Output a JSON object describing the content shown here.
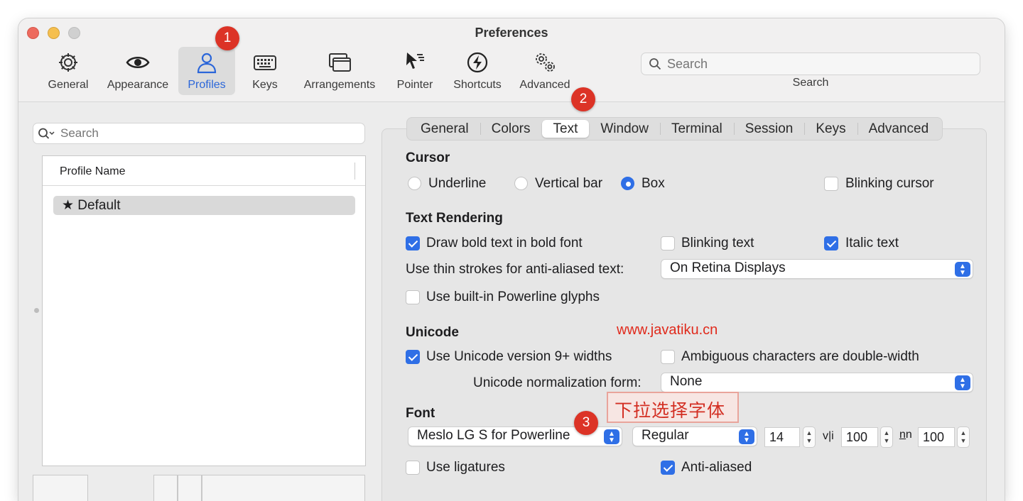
{
  "window": {
    "title": "Preferences"
  },
  "toolbar": {
    "items": [
      {
        "label": "General",
        "icon": "gear-icon"
      },
      {
        "label": "Appearance",
        "icon": "eye-icon"
      },
      {
        "label": "Profiles",
        "icon": "person-icon",
        "selected": true
      },
      {
        "label": "Keys",
        "icon": "keyboard-icon"
      },
      {
        "label": "Arrangements",
        "icon": "window-stack-icon"
      },
      {
        "label": "Pointer",
        "icon": "pointer-icon"
      },
      {
        "label": "Shortcuts",
        "icon": "bolt-icon"
      },
      {
        "label": "Advanced",
        "icon": "gears-icon"
      }
    ],
    "search": {
      "placeholder": "Search",
      "label": "Search"
    }
  },
  "badges": [
    "1",
    "2",
    "3"
  ],
  "sidebar": {
    "search_placeholder": "Search",
    "table_header": "Profile Name",
    "profiles": [
      "★ Default"
    ]
  },
  "tabs": [
    "General",
    "Colors",
    "Text",
    "Window",
    "Terminal",
    "Session",
    "Keys",
    "Advanced"
  ],
  "selected_tab": "Text",
  "cursor": {
    "heading": "Cursor",
    "options": [
      "Underline",
      "Vertical bar",
      "Box"
    ],
    "selected": "Box",
    "blinking_label": "Blinking cursor",
    "blinking": false
  },
  "text_rendering": {
    "heading": "Text Rendering",
    "draw_bold": {
      "label": "Draw bold text in bold font",
      "checked": true
    },
    "blinking_text": {
      "label": "Blinking text",
      "checked": false
    },
    "italic_text": {
      "label": "Italic text",
      "checked": true
    },
    "thin_strokes_label": "Use thin strokes for anti-aliased text:",
    "thin_strokes_value": "On Retina Displays",
    "powerline": {
      "label": "Use built-in Powerline glyphs",
      "checked": false
    }
  },
  "unicode": {
    "heading": "Unicode",
    "version9": {
      "label": "Use Unicode version 9+ widths",
      "checked": true
    },
    "ambiguous": {
      "label": "Ambiguous characters are double-width",
      "checked": false
    },
    "normalization_label": "Unicode normalization form:",
    "normalization_value": "None"
  },
  "font": {
    "heading": "Font",
    "family": "Meslo LG S for Powerline",
    "style": "Regular",
    "size": "14",
    "h_spacing_glyph": "v|i",
    "h_spacing": "100",
    "v_spacing_glyph": "n̲n",
    "v_spacing": "100",
    "ligatures": {
      "label": "Use ligatures",
      "checked": false
    },
    "anti_aliased": {
      "label": "Anti-aliased",
      "checked": true
    }
  },
  "watermark": "www.javatiku.cn",
  "annotation": "下拉选择字体",
  "colors": {
    "accent": "#2f6fe6",
    "badge": "#dc3326"
  }
}
